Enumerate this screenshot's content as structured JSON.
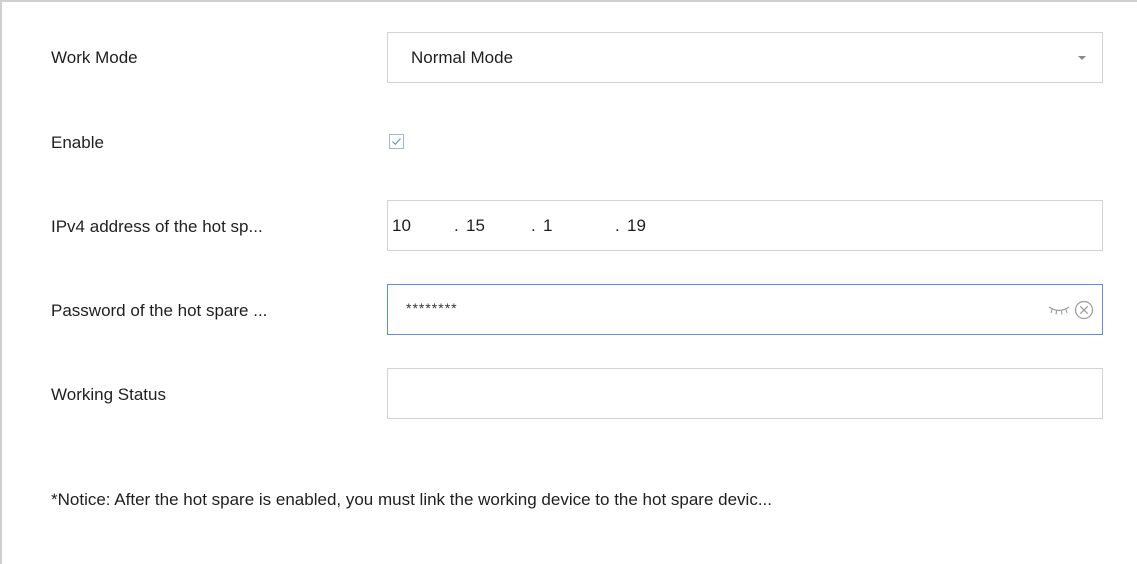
{
  "form": {
    "work_mode": {
      "label": "Work Mode",
      "value": "Normal Mode"
    },
    "enable": {
      "label": "Enable",
      "checked": true
    },
    "ipv4": {
      "label": "IPv4 address of the hot sp...",
      "octets": [
        "10",
        "15",
        "1",
        "19"
      ],
      "separator": "."
    },
    "password": {
      "label": "Password of the hot spare ...",
      "value": "********"
    },
    "working_status": {
      "label": "Working Status",
      "value": ""
    }
  },
  "notice": "*Notice: After the hot spare is enabled, you must link the working device to the hot spare devic...",
  "colors": {
    "focus_border": "#5b8fd6",
    "field_border": "#d3d3d3",
    "checkbox_border": "#9fb7d8"
  },
  "icons": [
    "dropdown-caret-icon",
    "checkmark-icon",
    "eye-closed-icon",
    "clear-circle-icon"
  ]
}
